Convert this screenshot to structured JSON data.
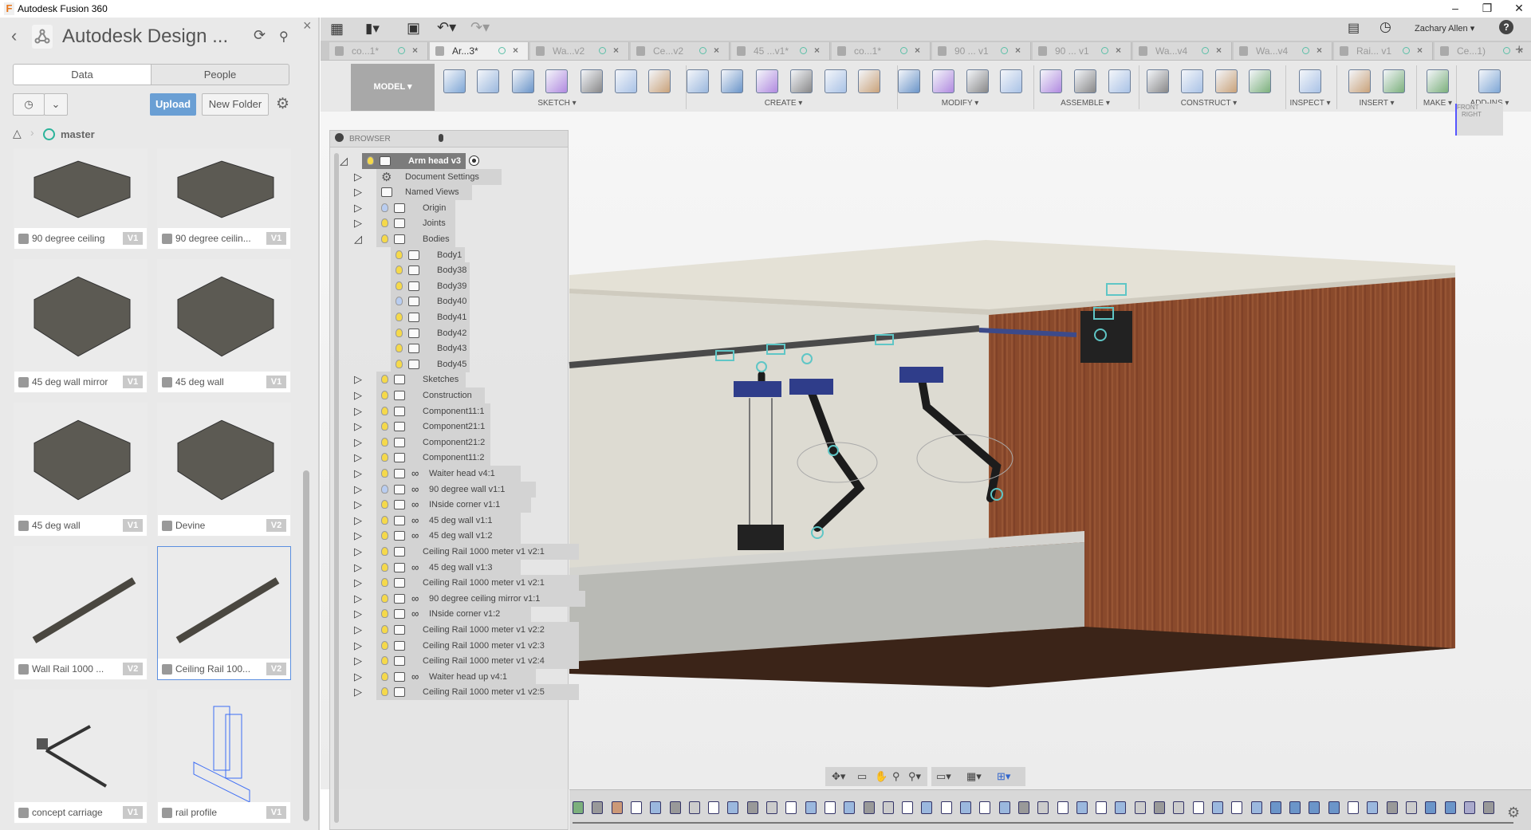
{
  "window": {
    "title": "Autodesk Fusion 360",
    "logo": "F",
    "minimize": "–",
    "maximize": "❐",
    "close": "✕"
  },
  "data_panel": {
    "title": "Autodesk Design ...",
    "close": "×",
    "tabs": [
      "Data",
      "People"
    ],
    "active_tab": "Data",
    "upload_label": "Upload",
    "new_folder_label": "New Folder",
    "breadcrumb": "master",
    "accent": "#6a9fd4",
    "cards": [
      {
        "name": "90 degree ceiling",
        "version": "V1",
        "thumb": "ceiling"
      },
      {
        "name": "90 degree ceilin...",
        "version": "V1",
        "thumb": "ceiling2"
      },
      {
        "name": "45 deg wall mirror",
        "version": "V1",
        "thumb": "wall"
      },
      {
        "name": "45 deg wall",
        "version": "V1",
        "thumb": "wall2"
      },
      {
        "name": "45 deg wall",
        "version": "V1",
        "thumb": "wall2"
      },
      {
        "name": "Devine",
        "version": "V2",
        "thumb": "devine"
      },
      {
        "name": "Wall Rail 1000 ...",
        "version": "V2",
        "thumb": "rail"
      },
      {
        "name": "Ceiling Rail 100...",
        "version": "V2",
        "thumb": "rail",
        "selected": true
      },
      {
        "name": "concept carriage",
        "version": "V1",
        "thumb": "carriage"
      },
      {
        "name": "rail profile",
        "version": "V1",
        "thumb": "profile"
      }
    ]
  },
  "app_toolbar": {
    "user": "Zachary Allen ▾",
    "help": "?"
  },
  "doc_tabs": [
    {
      "label": "co...1*"
    },
    {
      "label": "Ar...3*",
      "active": true
    },
    {
      "label": "Wa...v2"
    },
    {
      "label": "Ce...v2"
    },
    {
      "label": "45 ...v1*"
    },
    {
      "label": "co...1*"
    },
    {
      "label": "90 ... v1"
    },
    {
      "label": "90 ... v1"
    },
    {
      "label": "Wa...v4"
    },
    {
      "label": "Wa...v4"
    },
    {
      "label": "Rai... v1"
    },
    {
      "label": "Ce...1)"
    }
  ],
  "new_tab": "+",
  "ribbon": {
    "workspace": "MODEL ▾",
    "groups": [
      {
        "label": "SKETCH ▾",
        "icons": [
          "create-sketch",
          "line",
          "point",
          "polygon",
          "arc",
          "circle",
          "rectangle"
        ]
      },
      {
        "label": "CREATE ▾",
        "icons": [
          "extrude",
          "revolve",
          "sweep",
          "form",
          "coil-spring",
          "thread"
        ]
      },
      {
        "label": "MODIFY ▾",
        "icons": [
          "press-pull",
          "fillet",
          "split",
          "parameters"
        ]
      },
      {
        "label": "ASSEMBLE ▾",
        "icons": [
          "new-component",
          "joint",
          "as-built-joint"
        ]
      },
      {
        "label": "CONSTRUCT ▾",
        "icons": [
          "offset-plane",
          "midplane",
          "plane-through",
          "plane-angle"
        ]
      },
      {
        "label": "INSPECT ▾",
        "icons": [
          "measure"
        ]
      },
      {
        "label": "INSERT ▾",
        "icons": [
          "attached-canvas",
          "insert-svg"
        ]
      },
      {
        "label": "MAKE ▾",
        "icons": [
          "3d-print"
        ]
      },
      {
        "label": "ADD-INS ▾",
        "icons": [
          "scripts"
        ]
      }
    ]
  },
  "viewcube": {
    "front": "FRONT",
    "right": "RIGHT"
  },
  "browser": {
    "title": "BROWSER",
    "items": [
      {
        "label": "Arm head v3",
        "level": 0,
        "toggle": "open",
        "bulb": "yellow",
        "icon": "component",
        "active": true
      },
      {
        "label": "Document Settings",
        "level": 1,
        "toggle": "closed",
        "bulb": "none",
        "icon": "gear"
      },
      {
        "label": "Named Views",
        "level": 1,
        "toggle": "closed",
        "bulb": "none",
        "icon": "folder"
      },
      {
        "label": "Origin",
        "level": 1,
        "toggle": "closed",
        "bulb": "blue",
        "icon": "folder"
      },
      {
        "label": "Joints",
        "level": 1,
        "toggle": "closed",
        "bulb": "yellow",
        "icon": "folder"
      },
      {
        "label": "Bodies",
        "level": 1,
        "toggle": "open",
        "bulb": "yellow",
        "icon": "folder"
      },
      {
        "label": "Body1",
        "level": 2,
        "bulb": "yellow",
        "icon": "body"
      },
      {
        "label": "Body38",
        "level": 2,
        "bulb": "yellow",
        "icon": "body"
      },
      {
        "label": "Body39",
        "level": 2,
        "bulb": "yellow",
        "icon": "body"
      },
      {
        "label": "Body40",
        "level": 2,
        "bulb": "blue",
        "icon": "body"
      },
      {
        "label": "Body41",
        "level": 2,
        "bulb": "yellow",
        "icon": "body"
      },
      {
        "label": "Body42",
        "level": 2,
        "bulb": "yellow",
        "icon": "body"
      },
      {
        "label": "Body43",
        "level": 2,
        "bulb": "yellow",
        "icon": "body"
      },
      {
        "label": "Body45",
        "level": 2,
        "bulb": "yellow",
        "icon": "body"
      },
      {
        "label": "Sketches",
        "level": 1,
        "toggle": "closed",
        "bulb": "yellow",
        "icon": "folder"
      },
      {
        "label": "Construction",
        "level": 1,
        "toggle": "closed",
        "bulb": "yellow",
        "icon": "folder"
      },
      {
        "label": "Component11:1",
        "level": 1,
        "toggle": "closed",
        "bulb": "yellow",
        "icon": "component"
      },
      {
        "label": "Component21:1",
        "level": 1,
        "toggle": "closed",
        "bulb": "yellow",
        "icon": "component"
      },
      {
        "label": "Component21:2",
        "level": 1,
        "toggle": "closed",
        "bulb": "yellow",
        "icon": "component"
      },
      {
        "label": "Component11:2",
        "level": 1,
        "toggle": "closed",
        "bulb": "yellow",
        "icon": "component"
      },
      {
        "label": "Waiter head v4:1",
        "level": 1,
        "toggle": "closed",
        "bulb": "yellow",
        "icon": "component",
        "link": true
      },
      {
        "label": "90 degree wall v1:1",
        "level": 1,
        "toggle": "closed",
        "bulb": "blue",
        "icon": "body",
        "link": true
      },
      {
        "label": "INside corner v1:1",
        "level": 1,
        "toggle": "closed",
        "bulb": "yellow",
        "icon": "body",
        "link": true
      },
      {
        "label": "45 deg wall v1:1",
        "level": 1,
        "toggle": "closed",
        "bulb": "yellow",
        "icon": "body",
        "link": true
      },
      {
        "label": "45 deg wall v1:2",
        "level": 1,
        "toggle": "closed",
        "bulb": "yellow",
        "icon": "body",
        "link": true
      },
      {
        "label": "Ceiling Rail 1000 meter v1 v2:1",
        "level": 1,
        "toggle": "closed",
        "bulb": "yellow",
        "icon": "body"
      },
      {
        "label": "45 deg wall v1:3",
        "level": 1,
        "toggle": "closed",
        "bulb": "yellow",
        "icon": "body",
        "link": true
      },
      {
        "label": "Ceiling Rail 1000 meter v1 v2:1",
        "level": 1,
        "toggle": "closed",
        "bulb": "yellow",
        "icon": "body"
      },
      {
        "label": "90 degree ceiling mirror v1:1",
        "level": 1,
        "toggle": "closed",
        "bulb": "yellow",
        "icon": "body",
        "link": true
      },
      {
        "label": "INside corner v1:2",
        "level": 1,
        "toggle": "closed",
        "bulb": "yellow",
        "icon": "body",
        "link": true
      },
      {
        "label": "Ceiling Rail 1000 meter v1 v2:2",
        "level": 1,
        "toggle": "closed",
        "bulb": "yellow",
        "icon": "body"
      },
      {
        "label": "Ceiling Rail 1000 meter v1 v2:3",
        "level": 1,
        "toggle": "closed",
        "bulb": "yellow",
        "icon": "body"
      },
      {
        "label": "Ceiling Rail 1000 meter v1 v2:4",
        "level": 1,
        "toggle": "closed",
        "bulb": "yellow",
        "icon": "body"
      },
      {
        "label": "Waiter head up v4:1",
        "level": 1,
        "toggle": "closed",
        "bulb": "yellow",
        "icon": "component",
        "link": true
      },
      {
        "label": "Ceiling Rail 1000 meter v1 v2:5",
        "level": 1,
        "toggle": "closed",
        "bulb": "yellow",
        "icon": "body"
      }
    ]
  },
  "timeline": {
    "features": [
      "component",
      "joint",
      "plane",
      "sketch",
      "extrude",
      "joint",
      "move",
      "sketch",
      "extrude",
      "joint",
      "move",
      "sketch",
      "extrude",
      "sketch",
      "extrude",
      "joint",
      "move",
      "sketch",
      "extrude",
      "sketch",
      "extrude",
      "sketch",
      "extrude",
      "joint",
      "move",
      "sketch",
      "extrude",
      "sketch",
      "extrude",
      "move",
      "joint",
      "move",
      "sketch",
      "extrude",
      "sketch",
      "extrude",
      "fillet",
      "fillet",
      "fillet",
      "fillet",
      "sketch",
      "revolve",
      "joint",
      "move",
      "fillet",
      "fillet",
      "pattern",
      "joint"
    ]
  }
}
